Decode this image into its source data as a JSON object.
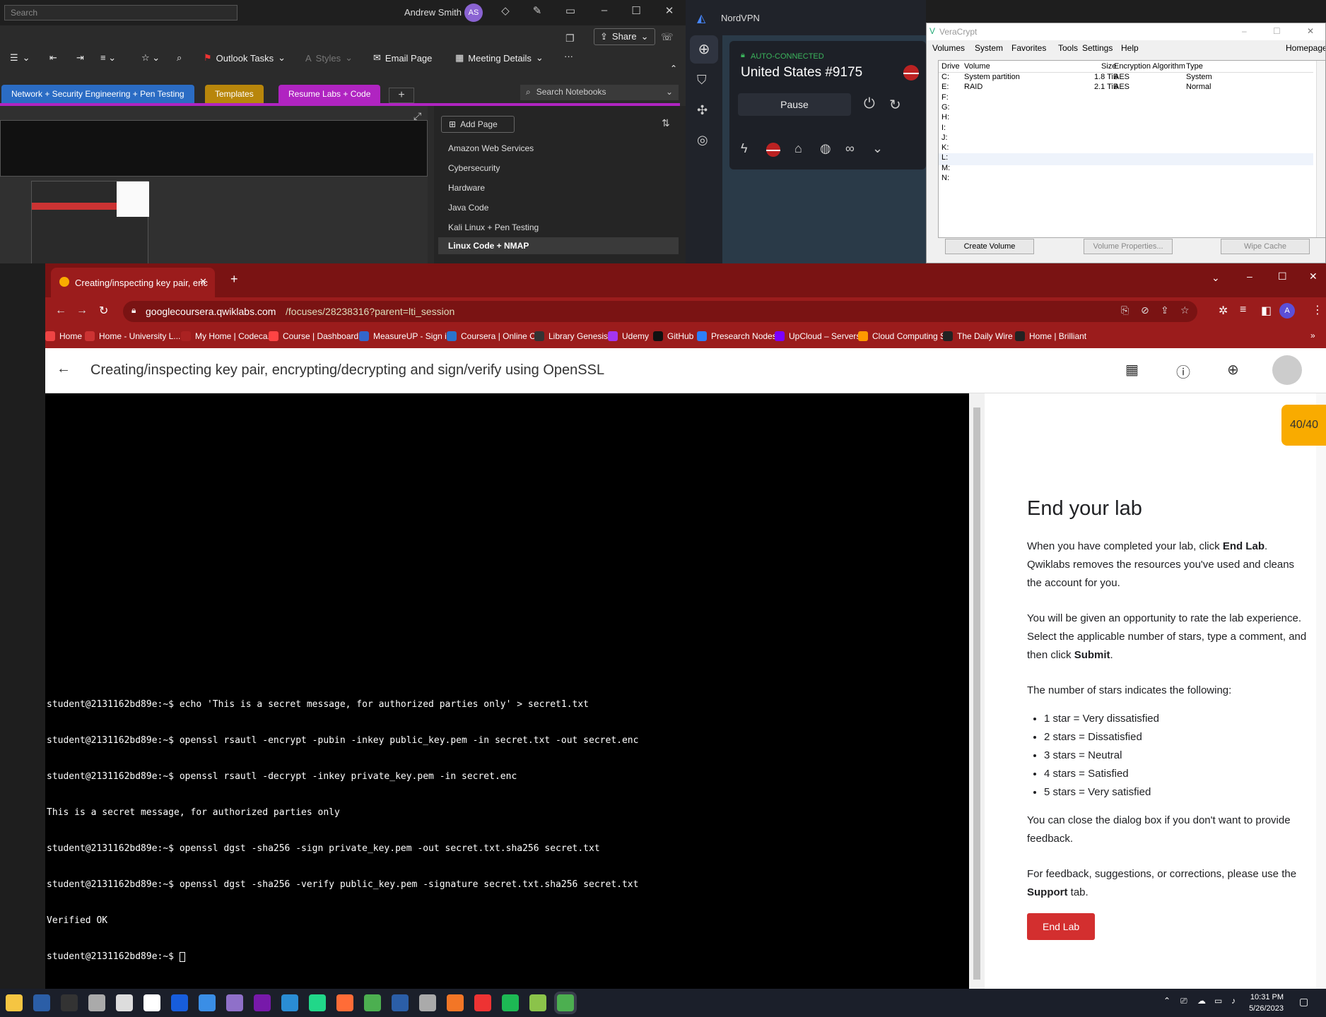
{
  "onenote": {
    "search_placeholder": "Search",
    "user_name": "Andrew Smith",
    "user_initials": "AS",
    "share_label": "Share",
    "ribbon": {
      "outlook_tasks": "Outlook Tasks",
      "styles": "Styles",
      "email_page": "Email Page",
      "meeting_details": "Meeting Details"
    },
    "notebook_tabs": [
      {
        "label": "Network + Security Engineering + Pen Testing",
        "color": "#2b6cc4"
      },
      {
        "label": "Templates",
        "color": "#b8860b"
      },
      {
        "label": "Resume Labs + Code",
        "color": "#b024c1"
      }
    ],
    "search_notebooks": "Search Notebooks",
    "add_page": "Add Page",
    "pages": [
      "Amazon Web Services",
      "Cybersecurity",
      "Hardware",
      "Java Code",
      "Kali Linux + Pen Testing",
      "Linux Code + NMAP"
    ]
  },
  "nordvpn": {
    "title": "NordVPN",
    "status": "AUTO-CONNECTED",
    "server": "United States #9175",
    "pause_label": "Pause"
  },
  "veracrypt": {
    "title": "VeraCrypt",
    "menu": [
      "Volumes",
      "System",
      "Favorites",
      "Tools",
      "Settings",
      "Help"
    ],
    "homepage": "Homepage",
    "columns": [
      "Drive",
      "Volume",
      "Size",
      "Encryption Algorithm",
      "Type"
    ],
    "drives": [
      {
        "drive": "C:",
        "volume": "System partition",
        "size": "1.8 TiB",
        "algo": "AES",
        "type": "System"
      },
      {
        "drive": "E:",
        "volume": "RAID",
        "size": "2.1 TiB",
        "algo": "AES",
        "type": "Normal"
      },
      {
        "drive": "F:",
        "volume": "",
        "size": "",
        "algo": "",
        "type": ""
      },
      {
        "drive": "G:",
        "volume": "",
        "size": "",
        "algo": "",
        "type": ""
      },
      {
        "drive": "H:",
        "volume": "",
        "size": "",
        "algo": "",
        "type": ""
      },
      {
        "drive": "I:",
        "volume": "",
        "size": "",
        "algo": "",
        "type": ""
      },
      {
        "drive": "J:",
        "volume": "",
        "size": "",
        "algo": "",
        "type": ""
      },
      {
        "drive": "K:",
        "volume": "",
        "size": "",
        "algo": "",
        "type": ""
      },
      {
        "drive": "L:",
        "volume": "",
        "size": "",
        "algo": "",
        "type": ""
      },
      {
        "drive": "M:",
        "volume": "",
        "size": "",
        "algo": "",
        "type": ""
      },
      {
        "drive": "N:",
        "volume": "",
        "size": "",
        "algo": "",
        "type": ""
      }
    ],
    "create_volume": "Create Volume",
    "volume_properties": "Volume Properties...",
    "wipe_cache": "Wipe Cache"
  },
  "chrome": {
    "tab_title": "Creating/inspecting key pair, enc",
    "url_host": "googlecoursera.qwiklabs.com",
    "url_path": "/focuses/28238316?parent=lti_session",
    "profile_initial": "A",
    "bookmarks": [
      {
        "label": "Home",
        "color": "#e44"
      },
      {
        "label": "Home - University L...",
        "color": "#c33"
      },
      {
        "label": "My Home | Codeca...",
        "color": "#a22"
      },
      {
        "label": "Course | Dashboard...",
        "color": "#f44"
      },
      {
        "label": "MeasureUP - Sign in",
        "color": "#36c"
      },
      {
        "label": "Coursera | Online C...",
        "color": "#2a73cc"
      },
      {
        "label": "Library Genesis",
        "color": "#333"
      },
      {
        "label": "Udemy",
        "color": "#a435f0"
      },
      {
        "label": "GitHub",
        "color": "#111"
      },
      {
        "label": "Presearch Nodes",
        "color": "#2d7ff9"
      },
      {
        "label": "UpCloud – Servers",
        "color": "#7b00ff"
      },
      {
        "label": "Cloud Computing S...",
        "color": "#f90"
      },
      {
        "label": "The Daily Wire",
        "color": "#222"
      },
      {
        "label": "Home | Brilliant",
        "color": "#222"
      }
    ],
    "page_title": "Creating/inspecting key pair, encrypting/decrypting and sign/verify using OpenSSL",
    "terminal_lines": [
      "student@2131162bd89e:~$ echo 'This is a secret message, for authorized parties only' > secret1.txt",
      "student@2131162bd89e:~$ openssl rsautl -encrypt -pubin -inkey public_key.pem -in secret.txt -out secret.enc",
      "student@2131162bd89e:~$ openssl rsautl -decrypt -inkey private_key.pem -in secret.enc",
      "This is a secret message, for authorized parties only",
      "student@2131162bd89e:~$ openssl dgst -sha256 -sign private_key.pem -out secret.txt.sha256 secret.txt",
      "student@2131162bd89e:~$ openssl dgst -sha256 -verify public_key.pem -signature secret.txt.sha256 secret.txt",
      "Verified OK",
      "student@2131162bd89e:~$ "
    ],
    "score": "40/40",
    "panel": {
      "heading": "End your lab",
      "p1_a": "When you have completed your lab, click ",
      "p1_b": "End Lab",
      "p1_c": ". Qwiklabs removes the resources you've used and cleans the account for you.",
      "p2_a": "You will be given an opportunity to rate the lab experience. Select the applicable number of stars, type a comment, and then click ",
      "p2_b": "Submit",
      "p2_c": ".",
      "p3": "The number of stars indicates the following:",
      "stars": [
        "1 star = Very dissatisfied",
        "2 stars = Dissatisfied",
        "3 stars = Neutral",
        "4 stars = Satisfied",
        "5 stars = Very satisfied"
      ],
      "p4": "You can close the dialog box if you don't want to provide feedback.",
      "p5_a": "For feedback, suggestions, or corrections, please use the ",
      "p5_b": "Support",
      "p5_c": " tab.",
      "end_lab_button": "End Lab"
    }
  },
  "taskbar": {
    "time": "10:31 PM",
    "date": "5/26/2023",
    "apps": [
      {
        "name": "file-explorer-icon",
        "color": "#f5c542"
      },
      {
        "name": "powershell-icon",
        "color": "#2b5ea7"
      },
      {
        "name": "terminal-icon",
        "color": "#333"
      },
      {
        "name": "settings-icon",
        "color": "#aaa"
      },
      {
        "name": "notepad-icon",
        "color": "#ddd"
      },
      {
        "name": "7zip-icon",
        "color": "#fff"
      },
      {
        "name": "bitwarden-icon",
        "color": "#175ddc"
      },
      {
        "name": "store-icon",
        "color": "#3a8ee6"
      },
      {
        "name": "visual-studio-icon",
        "color": "#8f70c9"
      },
      {
        "name": "onenote-icon",
        "color": "#7719aa"
      },
      {
        "name": "vscode-icon",
        "color": "#2a8dd4"
      },
      {
        "name": "pycharm-icon",
        "color": "#21d789"
      },
      {
        "name": "postman-icon",
        "color": "#ff6c37"
      },
      {
        "name": "chrome-icon",
        "color": "#4caf50"
      },
      {
        "name": "putty-icon",
        "color": "#2b5ea7"
      },
      {
        "name": "virtualbox-icon",
        "color": "#aaa"
      },
      {
        "name": "jupyter-icon",
        "color": "#f37626"
      },
      {
        "name": "xmind-icon",
        "color": "#e33"
      },
      {
        "name": "spotify-icon",
        "color": "#1db954"
      },
      {
        "name": "app-icon",
        "color": "#8bc34a"
      },
      {
        "name": "chrome-active-icon",
        "color": "#4caf50"
      }
    ]
  }
}
